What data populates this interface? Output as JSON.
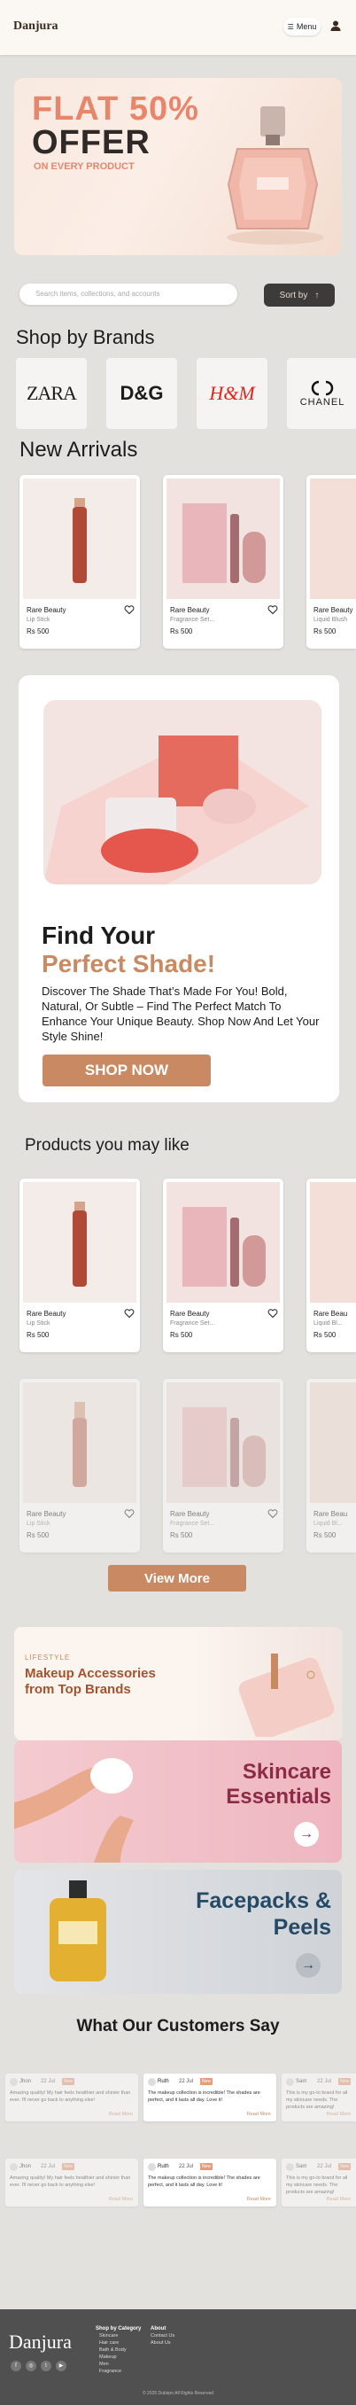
{
  "header": {
    "logo": "Danjura",
    "menu_label": "Menu"
  },
  "hero": {
    "line1": "FLAT 50%",
    "line2": "OFFER",
    "line3": "ON EVERY PRODUCT"
  },
  "search": {
    "placeholder": "Search items, collections, and accounts"
  },
  "sort": {
    "label": "Sort by"
  },
  "brands": {
    "title": "Shop by Brands",
    "items": [
      "ZARA",
      "D&G",
      "H&M",
      "CHANEL"
    ]
  },
  "new_arrivals": {
    "title": "New Arrivals",
    "items": [
      {
        "name": "Rare Beauty",
        "sub": "Lip Stick",
        "price": "Rs 500"
      },
      {
        "name": "Rare Beauty",
        "sub": "Fragrance Set...",
        "price": "Rs 500"
      },
      {
        "name": "Rare Beauty",
        "sub": "Liquid Blush",
        "price": "Rs 500"
      }
    ]
  },
  "promo": {
    "title1": "Find Your",
    "title2": "Perfect Shade!",
    "body": "Discover The Shade That’s Made For You! Bold, Natural, Or Subtle – Find The Perfect Match To Enhance Your Unique Beauty. Shop Now And Let Your Style Shine!",
    "button": "SHOP NOW"
  },
  "may_like": {
    "title": "Products you may like",
    "row1": [
      {
        "name": "Rare Beauty",
        "sub": "Lip Stick",
        "price": "Rs 500"
      },
      {
        "name": "Rare Beauty",
        "sub": "Fragrance Set...",
        "price": "Rs 500"
      },
      {
        "name": "Rare Beau",
        "sub": "Liquid Bl...",
        "price": "Rs 500"
      }
    ],
    "row2": [
      {
        "name": "Rare Beauty",
        "sub": "Lip Stick",
        "price": "Rs 500"
      },
      {
        "name": "Rare Beauty",
        "sub": "Fragrance Set...",
        "price": "Rs 500"
      },
      {
        "name": "Rare Beau",
        "sub": "Liquid Bl...",
        "price": "Rs 500"
      }
    ],
    "view_more": "View More"
  },
  "categories": [
    {
      "eyebrow": "LIFESTYLE",
      "title": "Makeup Accessories from Top Brands"
    },
    {
      "title": "Skincare Essentials"
    },
    {
      "title": "Facepacks & Peels"
    }
  ],
  "reviews": {
    "title": "What Our Customers Say",
    "items": [
      {
        "name": "Jhon",
        "date": "22 Jul",
        "badge": "New",
        "text": "Amazing quality! My hair feels healthier and shinier than ever. I'll never go back to anything else!",
        "more": "Read More"
      },
      {
        "name": "Ruth",
        "date": "22 Jul",
        "badge": "New",
        "text": "The makeup collection is incredible! The shades are perfect, and it lasts all day. Love it!",
        "more": "Read More"
      },
      {
        "name": "Sam",
        "date": "22 Jul",
        "badge": "New",
        "text": "This is my go-to brand for all my skincare needs. The products are amazing!",
        "more": "Read More"
      }
    ]
  },
  "footer": {
    "logo": "Danjura",
    "col1_title": "Shop by Category",
    "col1": [
      "Skincare",
      "Hair care",
      "Bath & Body",
      "Makeup",
      "Men",
      "Fragrance"
    ],
    "col2_title": "About",
    "col2": [
      "Contact Us",
      "About Us"
    ],
    "copyright": "© 2025 Dubiqro All Rights Reserved"
  },
  "colors": {
    "accent": "#c98a63",
    "hero_orange": "#e8866c",
    "dark": "#3d3b39"
  }
}
